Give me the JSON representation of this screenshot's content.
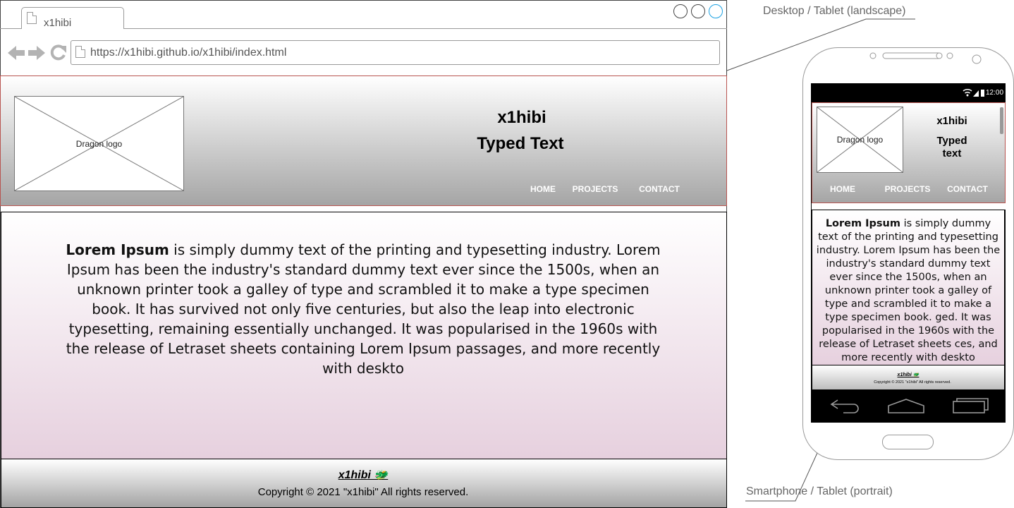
{
  "desktop": {
    "tab_title": "x1hibi",
    "url": "https://x1hibi.github.io/x1hibi/index.html",
    "logo_label": "Dragon logo",
    "site_title": "x1hibi",
    "typed_text": "Typed Text",
    "nav": [
      "HOME",
      "PROJECTS",
      "CONTACT"
    ],
    "body_lead": "Lorem Ipsum",
    "body_rest": " is simply dummy text of the printing and typesetting industry. Lorem Ipsum has been the industry's standard dummy text ever since the 1500s, when an unknown printer took a galley of type and scrambled it to make a type specimen book. It has survived not only five centuries, but also the leap into electronic typesetting, remaining essentially unchanged. It was popularised in the 1960s with the release of Letraset sheets containing Lorem Ipsum passages, and more recently with deskto",
    "footer_brand": "x1hibi 🐲",
    "footer_copy": "Copyright © 2021 \"x1hibi\"  All rights reserved."
  },
  "phone": {
    "status_time": "12:00",
    "logo_label": "Dragon logo",
    "site_title": "x1hibi",
    "typed_text": "Typed text",
    "nav": [
      "HOME",
      "PROJECTS",
      "CONTACT"
    ],
    "body_lead": "Lorem Ipsum",
    "body_rest": " is simply dummy text of the printing and typesetting industry. Lorem Ipsum has been the industry's standard dummy text ever since the 1500s, when an unknown printer took a galley of type and scrambled it to make a type specimen book. ged. It was popularised in the 1960s with the release of Letraset sheets ces, and more recently with deskto",
    "footer_brand": "x1hibi 🐲",
    "footer_copy": "Copyright © 2021 \"x1hibi\"  All rights reserved."
  },
  "callouts": {
    "desktop": "Desktop / Tablet (landscape)",
    "phone": "Smartphone / Tablet (portrait)"
  },
  "icons": [
    "page-icon",
    "back-arrow-icon",
    "forward-arrow-icon",
    "reload-icon",
    "wifi-icon",
    "signal-icon",
    "battery-icon",
    "android-back-icon",
    "android-home-icon",
    "android-recents-icon"
  ],
  "colors": {
    "header_border": "#b85450",
    "content_gradient_end": "#e6d0de",
    "active_window_button": "#1ba1e2"
  }
}
